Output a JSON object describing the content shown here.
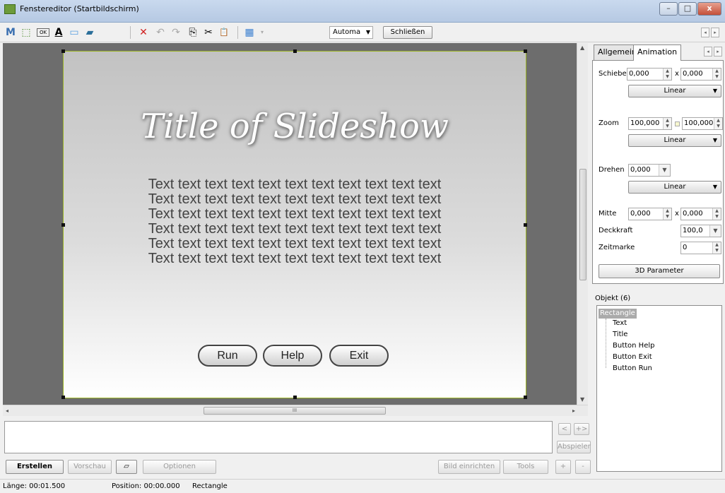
{
  "window": {
    "title": "Fenstereditor (Startbildschirm)"
  },
  "titlebar_buttons": {
    "minimize": "–",
    "maximize": "□",
    "close": "x"
  },
  "toolbar": {
    "icons": {
      "mask": "M",
      "select": "⬚",
      "ok": "OK",
      "text": "A",
      "rect": "▭",
      "image": "▰",
      "delete": "✕",
      "undo": "↶",
      "redo": "↷",
      "copy": "⎘",
      "cut": "✂",
      "paste": "📋",
      "grid": "▦"
    },
    "mode_combo": "Automa",
    "close_label": "Schließen"
  },
  "slide": {
    "title": "Title of Slideshow",
    "text_lines": [
      "Text text text text text text text text text text text",
      "Text text text text text text text text text text text",
      "Text text text text text text text text text text text",
      "Text text text text text text text text text text text",
      "Text text text text text text text text text text text",
      "Text text text text text text text text text text text"
    ],
    "buttons": [
      "Run",
      "Help",
      "Exit"
    ]
  },
  "hscroll_grip": "III",
  "right_panel": {
    "tabs": [
      "Allgemein",
      "Animation"
    ],
    "active_tab": "Animation",
    "schieber": {
      "label": "Schieber",
      "x": "0,000",
      "sep": "x",
      "y": "0,000",
      "easing": "Linear"
    },
    "zoom": {
      "label": "Zoom",
      "x": "100,000",
      "y": "100,000",
      "easing": "Linear"
    },
    "drehen": {
      "label": "Drehen",
      "value": "0,000",
      "easing": "Linear"
    },
    "mitte": {
      "label": "Mitte",
      "x": "0,000",
      "sep": "x",
      "y": "0,000"
    },
    "deckkraft": {
      "label": "Deckkraft",
      "value": "100,0"
    },
    "zeitmarke": {
      "label": "Zeitmarke",
      "value": "0"
    },
    "param_button": "3D Parameter",
    "objects": {
      "header": "Objekt (6)",
      "items": [
        "Rectangle",
        "Text",
        "Title",
        "Button Help",
        "Button Exit",
        "Button Run"
      ]
    }
  },
  "timeline_buttons": {
    "prev": "<",
    "next": "+>",
    "play": "Abspielen",
    "plus": "+",
    "minus": "-"
  },
  "bottom_buttons": {
    "erstellen": "Erstellen",
    "vorschau": "Vorschau",
    "optionen": "Optionen",
    "bild": "Bild einrichten",
    "tools": "Tools"
  },
  "status": {
    "laenge": "Länge: 00:01.500",
    "position": "Position: 00:00.000",
    "object": "Rectangle"
  },
  "colors": {
    "selection_border": "#9ab324",
    "canvas_bg": "#6d6d6d",
    "tree_selected": "#aaaaaa"
  }
}
